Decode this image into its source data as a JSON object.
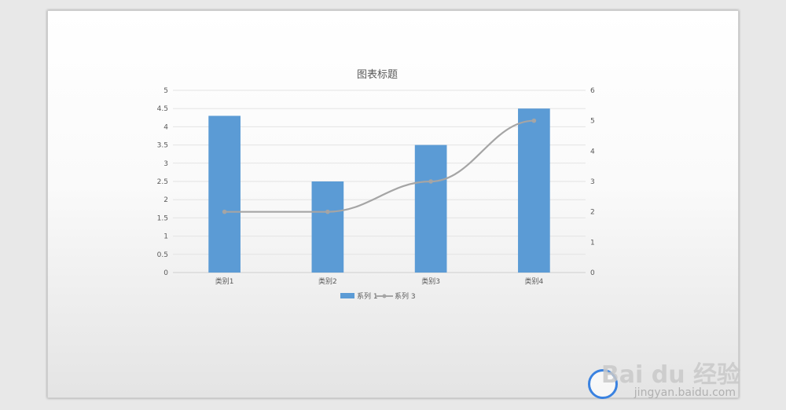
{
  "chart_data": {
    "type": "bar",
    "title": "图表标题",
    "categories": [
      "类别1",
      "类别2",
      "类别3",
      "类别4"
    ],
    "series": [
      {
        "name": "系列 1",
        "type": "bar",
        "axis": "left",
        "values": [
          4.3,
          2.5,
          3.5,
          4.5
        ],
        "color": "#5b9bd5"
      },
      {
        "name": "系列 3",
        "type": "line",
        "axis": "right",
        "values": [
          2,
          2,
          3,
          5
        ],
        "color": "#a5a5a5"
      }
    ],
    "y_left": {
      "range": [
        0,
        5
      ],
      "ticks": [
        "0",
        "0.5",
        "1",
        "1.5",
        "2",
        "2.5",
        "3",
        "3.5",
        "4",
        "4.5",
        "5"
      ]
    },
    "y_right": {
      "range": [
        0,
        6
      ],
      "ticks": [
        "0",
        "1",
        "2",
        "3",
        "4",
        "5",
        "6"
      ]
    },
    "grid": true,
    "legend_position": "bottom"
  },
  "watermark": {
    "brand": "Bai du 经验",
    "url": "jingyan.baidu.com"
  }
}
